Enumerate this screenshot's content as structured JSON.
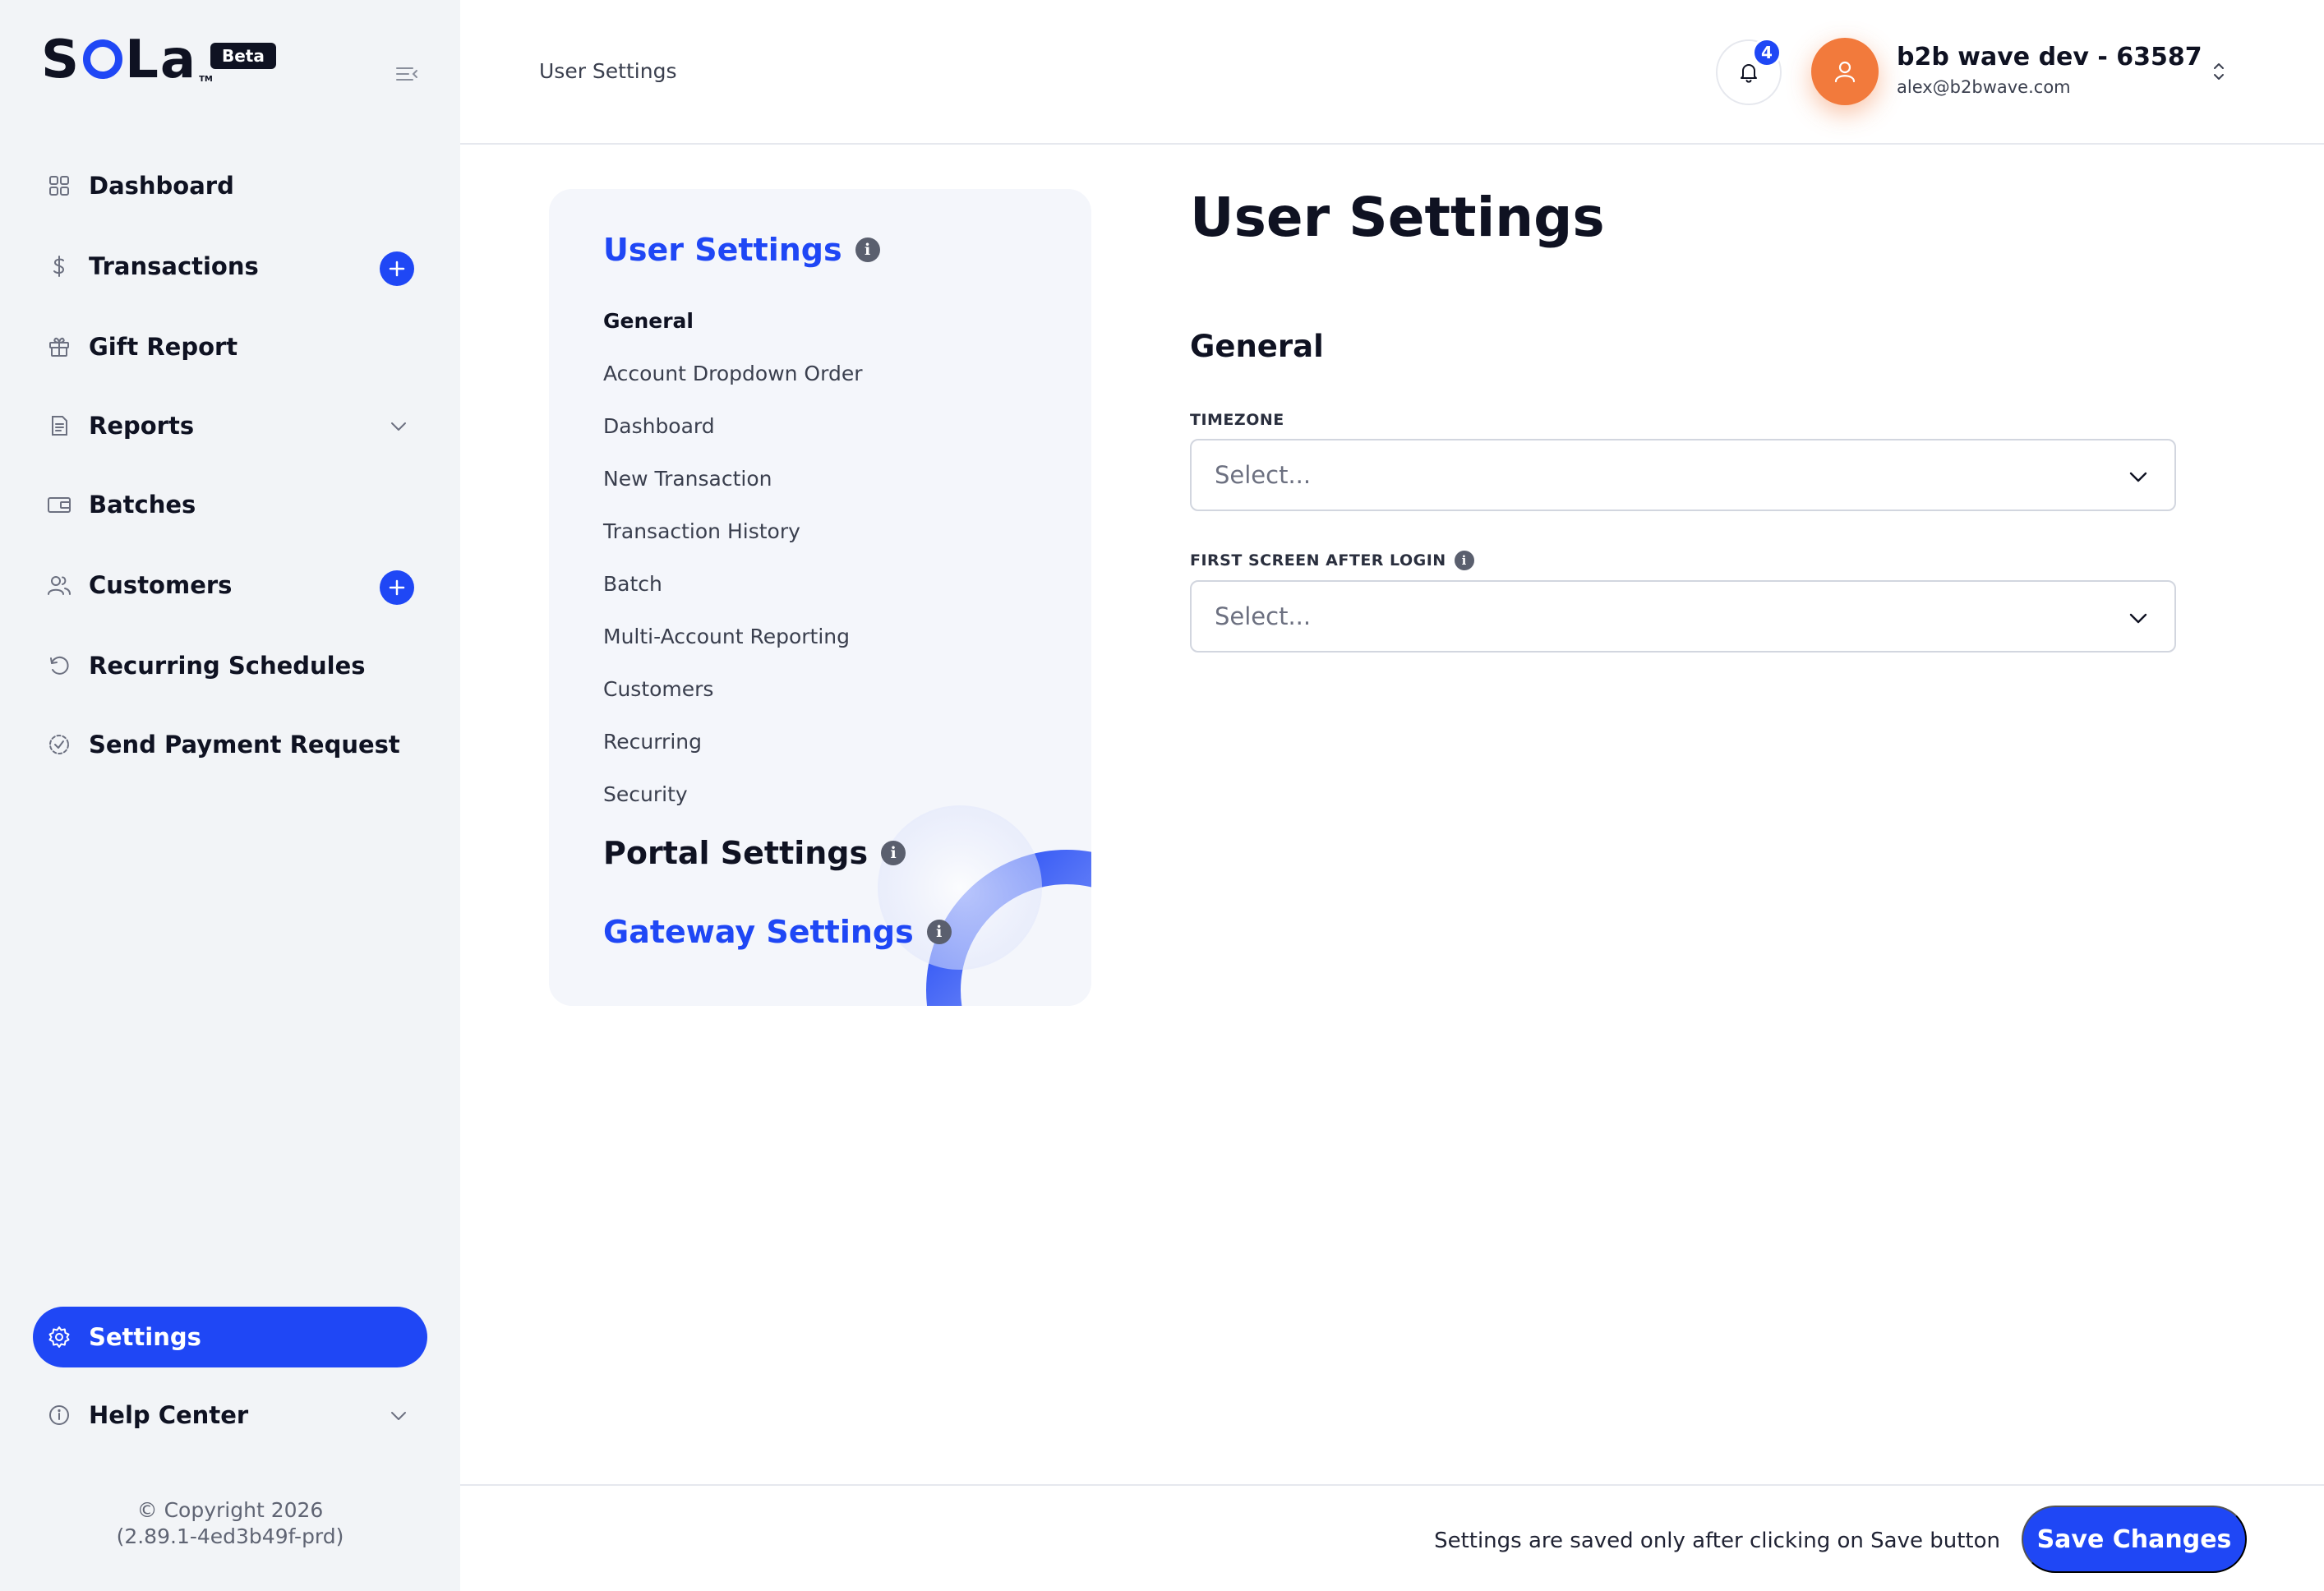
{
  "brand": {
    "name": "SOLa",
    "name_prefix": "S",
    "name_suffix": "La",
    "trademark": "TM",
    "badge": "Beta"
  },
  "sidebar": {
    "items": [
      {
        "label": "Dashboard",
        "icon": "grid-icon"
      },
      {
        "label": "Transactions",
        "icon": "dollar-icon",
        "has_add": true
      },
      {
        "label": "Gift Report",
        "icon": "gift-icon"
      },
      {
        "label": "Reports",
        "icon": "document-icon",
        "has_chevron": true
      },
      {
        "label": "Batches",
        "icon": "wallet-icon"
      },
      {
        "label": "Customers",
        "icon": "users-icon",
        "has_add": true
      },
      {
        "label": "Recurring Schedules",
        "icon": "refresh-icon"
      },
      {
        "label": "Send Payment Request",
        "icon": "payment-request-icon"
      }
    ],
    "settings_label": "Settings",
    "help_label": "Help Center",
    "copyright_line1": "© Copyright 2026",
    "copyright_line2": "(2.89.1-4ed3b49f-prd)"
  },
  "header": {
    "title": "User Settings",
    "notification_count": "4",
    "account_name": "b2b wave dev - 63587",
    "account_email": "alex@b2bwave.com"
  },
  "subnav": {
    "user_settings": "User Settings",
    "items": [
      "General",
      "Account Dropdown Order",
      "Dashboard",
      "New Transaction",
      "Transaction History",
      "Batch",
      "Multi-Account Reporting",
      "Customers",
      "Recurring",
      "Security"
    ],
    "active_index": 0,
    "portal_settings": "Portal Settings",
    "gateway_settings": "Gateway Settings"
  },
  "main": {
    "page_title": "User Settings",
    "section_title": "General",
    "fields": [
      {
        "label": "TIMEZONE",
        "placeholder": "Select...",
        "has_info": false
      },
      {
        "label": "FIRST SCREEN AFTER LOGIN",
        "placeholder": "Select...",
        "has_info": true
      }
    ]
  },
  "footer": {
    "note": "Settings are saved only after clicking on Save button",
    "save_label": "Save Changes"
  },
  "colors": {
    "accent": "#1f47f5",
    "avatar": "#f27a3c",
    "sidebar_bg": "#f2f4f7",
    "text": "#0f1222"
  }
}
